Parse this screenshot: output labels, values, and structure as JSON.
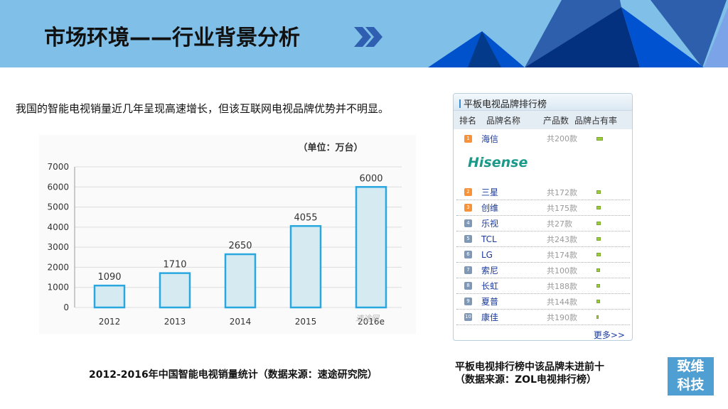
{
  "header": {
    "title": "市场环境——行业背景分析"
  },
  "intro": "我国的智能电视销量近几年呈现高速增长，但该互联网电视品牌优势并不明显。",
  "chart_data": {
    "type": "bar",
    "title": "（单位：万台）",
    "categories": [
      "2012",
      "2013",
      "2014",
      "2015",
      "2016e"
    ],
    "values": [
      1090,
      1710,
      2650,
      4055,
      6000
    ],
    "ylim": [
      0,
      7000
    ],
    "yticks": [
      "0",
      "1000",
      "2000",
      "3000",
      "4000",
      "5000",
      "6000",
      "7000"
    ],
    "xlabel": "",
    "ylabel": "",
    "bar_color": "#d6eaf2",
    "bar_border": "#29a8df",
    "watermark": "速途网"
  },
  "chart_caption": "2012-2016年中国智能电视销量统计（数据来源：速途研究院）",
  "ranking": {
    "title": "平板电视品牌排行榜",
    "columns": [
      "排名",
      "品牌名称",
      "产品数",
      "品牌占有率"
    ],
    "logo": "Hisense",
    "more": "更多>>",
    "rows": [
      {
        "rank": "1",
        "brand": "海信",
        "count": "共200款",
        "share": 0.9
      },
      {
        "rank": "2",
        "brand": "三星",
        "count": "共172款",
        "share": 0.6
      },
      {
        "rank": "3",
        "brand": "创维",
        "count": "共175款",
        "share": 0.6
      },
      {
        "rank": "4",
        "brand": "乐视",
        "count": "共27款",
        "share": 0.6
      },
      {
        "rank": "5",
        "brand": "TCL",
        "count": "共243款",
        "share": 0.6
      },
      {
        "rank": "6",
        "brand": "LG",
        "count": "共174款",
        "share": 0.6
      },
      {
        "rank": "7",
        "brand": "索尼",
        "count": "共100款",
        "share": 0.45
      },
      {
        "rank": "8",
        "brand": "长虹",
        "count": "共188款",
        "share": 0.45
      },
      {
        "rank": "9",
        "brand": "夏普",
        "count": "共144款",
        "share": 0.45
      },
      {
        "rank": "10",
        "brand": "康佳",
        "count": "共190款",
        "share": 0.3
      }
    ]
  },
  "ranking_caption": [
    "平板电视排行榜中该品牌未进前十",
    "（数据来源：ZOL电视排行榜）"
  ],
  "logo": [
    "致维",
    "科技"
  ]
}
